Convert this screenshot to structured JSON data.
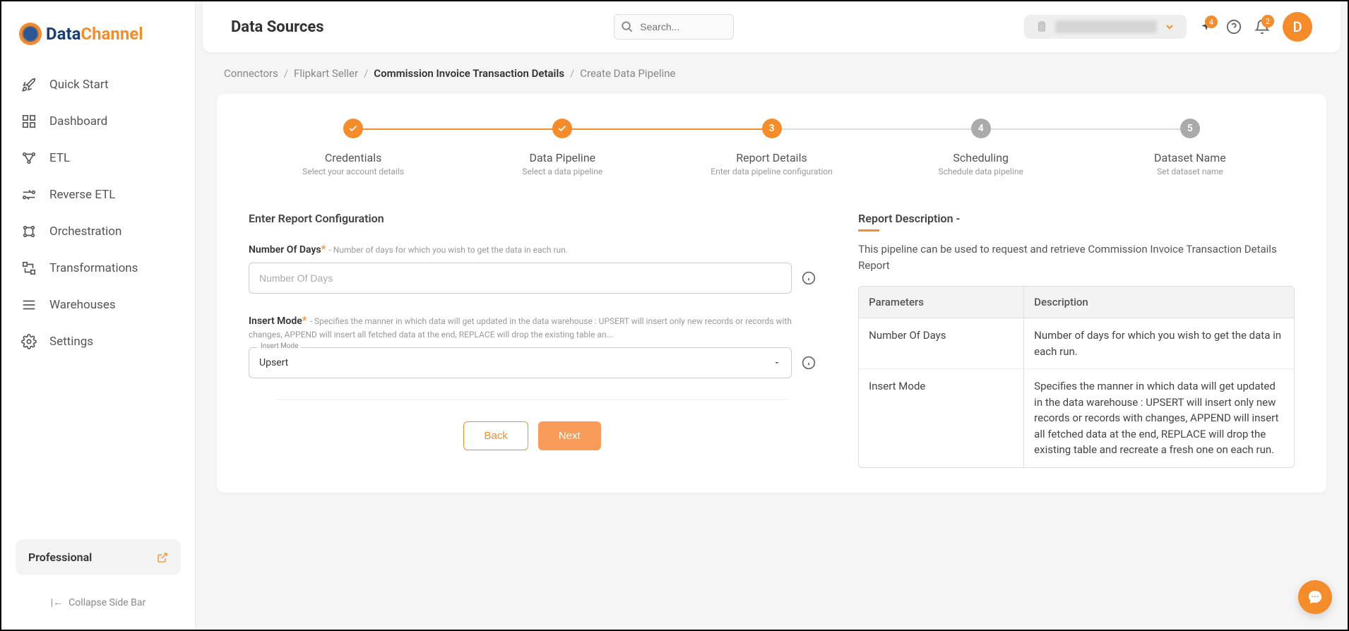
{
  "logo": {
    "text1": "Data",
    "text2": "Channel"
  },
  "sidebar": {
    "items": [
      {
        "label": "Quick Start"
      },
      {
        "label": "Dashboard"
      },
      {
        "label": "ETL"
      },
      {
        "label": "Reverse ETL"
      },
      {
        "label": "Orchestration"
      },
      {
        "label": "Transformations"
      },
      {
        "label": "Warehouses"
      },
      {
        "label": "Settings"
      }
    ],
    "plan": "Professional",
    "collapse": "Collapse Side Bar"
  },
  "header": {
    "title": "Data Sources",
    "search_placeholder": "Search...",
    "sparkle_badge": "4",
    "bell_badge": "2",
    "avatar": "D"
  },
  "breadcrumb": {
    "items": [
      "Connectors",
      "Flipkart Seller",
      "Commission Invoice Transaction Details",
      "Create Data Pipeline"
    ],
    "active_index": 2
  },
  "stepper": [
    {
      "title": "Credentials",
      "sub": "Select your account details",
      "state": "done",
      "mark": "✓"
    },
    {
      "title": "Data Pipeline",
      "sub": "Select a data pipeline",
      "state": "done",
      "mark": "✓"
    },
    {
      "title": "Report Details",
      "sub": "Enter data pipeline configuration",
      "state": "active",
      "mark": "3"
    },
    {
      "title": "Scheduling",
      "sub": "Schedule data pipeline",
      "state": "pending",
      "mark": "4"
    },
    {
      "title": "Dataset Name",
      "sub": "Set dataset name",
      "state": "pending",
      "mark": "5"
    }
  ],
  "form": {
    "section_title": "Enter Report Configuration",
    "number_of_days": {
      "label": "Number Of Days",
      "required": "*",
      "help": "- Number of days for which you wish to get the data in each run.",
      "placeholder": "Number Of Days"
    },
    "insert_mode": {
      "label": "Insert Mode",
      "required": "*",
      "help": "- Specifies the manner in which data will get updated in the data warehouse : UPSERT will insert only new records or records with changes, APPEND will insert all fetched data at the end, REPLACE will drop the existing table an...",
      "float_label": "Insert Mode",
      "value": "Upsert"
    },
    "back": "Back",
    "next": "Next"
  },
  "description": {
    "title": "Report Description -",
    "text": "This pipeline can be used to request and retrieve Commission Invoice Transaction Details Report",
    "table": {
      "headers": [
        "Parameters",
        "Description"
      ],
      "rows": [
        {
          "param": "Number Of Days",
          "desc": "Number of days for which you wish to get the data in each run."
        },
        {
          "param": "Insert Mode",
          "desc": "Specifies the manner in which data will get updated in the data warehouse : UPSERT will insert only new records or records with changes, APPEND will insert all fetched data at the end, REPLACE will drop the existing table and recreate a fresh one on each run."
        }
      ]
    }
  }
}
